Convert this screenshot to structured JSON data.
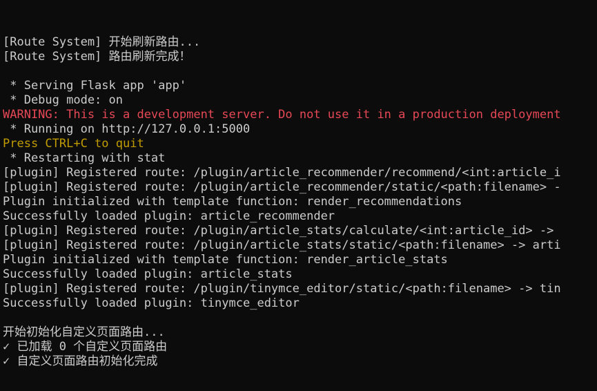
{
  "terminal": {
    "lines": [
      {
        "text": "[Route System] 开始刷新路由...",
        "style": "normal"
      },
      {
        "text": "[Route System] 路由刷新完成！",
        "style": "normal"
      },
      {
        "text": "",
        "style": "normal"
      },
      {
        "text": " * Serving Flask app 'app'",
        "style": "normal"
      },
      {
        "text": " * Debug mode: on",
        "style": "normal"
      },
      {
        "text": "WARNING: This is a development server. Do not use it in a production deployment",
        "style": "red"
      },
      {
        "text": " * Running on http://127.0.0.1:5000",
        "style": "normal"
      },
      {
        "text": "Press CTRL+C to quit",
        "style": "yellow"
      },
      {
        "text": " * Restarting with stat",
        "style": "normal"
      },
      {
        "text": "[plugin] Registered route: /plugin/article_recommender/recommend/<int:article_i",
        "style": "normal"
      },
      {
        "text": "[plugin] Registered route: /plugin/article_recommender/static/<path:filename> -",
        "style": "normal"
      },
      {
        "text": "Plugin initialized with template function: render_recommendations",
        "style": "normal"
      },
      {
        "text": "Successfully loaded plugin: article_recommender",
        "style": "normal"
      },
      {
        "text": "[plugin] Registered route: /plugin/article_stats/calculate/<int:article_id> ->",
        "style": "normal"
      },
      {
        "text": "[plugin] Registered route: /plugin/article_stats/static/<path:filename> -> arti",
        "style": "normal"
      },
      {
        "text": "Plugin initialized with template function: render_article_stats",
        "style": "normal"
      },
      {
        "text": "Successfully loaded plugin: article_stats",
        "style": "normal"
      },
      {
        "text": "[plugin] Registered route: /plugin/tinymce_editor/static/<path:filename> -> tin",
        "style": "normal"
      },
      {
        "text": "Successfully loaded plugin: tinymce_editor",
        "style": "normal"
      },
      {
        "text": "",
        "style": "normal"
      },
      {
        "text": "开始初始化自定义页面路由...",
        "style": "normal"
      },
      {
        "text": "✓ 已加载 0 个自定义页面路由",
        "style": "normal"
      },
      {
        "text": "✓ 自定义页面路由初始化完成",
        "style": "normal"
      }
    ]
  }
}
